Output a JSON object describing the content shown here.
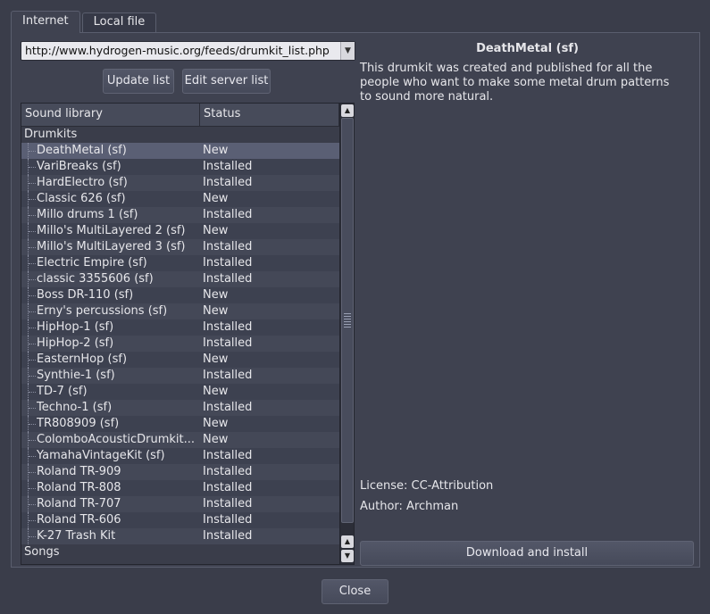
{
  "tabs": [
    {
      "label": "Internet",
      "active": true
    },
    {
      "label": "Local file",
      "active": false
    }
  ],
  "url": {
    "value": "http://www.hydrogen-music.org/feeds/drumkit_list.php"
  },
  "buttons": {
    "update_list": "Update list",
    "edit_server_list": "Edit server list",
    "download_install": "Download and install",
    "close": "Close"
  },
  "tree": {
    "headers": {
      "name": "Sound library",
      "status": "Status"
    },
    "groups": {
      "drumkits": "Drumkits",
      "songs": "Songs"
    },
    "items": [
      {
        "name": "DeathMetal (sf)",
        "status": "New",
        "selected": true
      },
      {
        "name": "VariBreaks (sf)",
        "status": "Installed"
      },
      {
        "name": "HardElectro (sf)",
        "status": "Installed"
      },
      {
        "name": "Classic 626 (sf)",
        "status": "New"
      },
      {
        "name": "Millo drums 1 (sf)",
        "status": "Installed"
      },
      {
        "name": "Millo's MultiLayered 2 (sf)",
        "status": "New"
      },
      {
        "name": "Millo's MultiLayered 3 (sf)",
        "status": "Installed"
      },
      {
        "name": "Electric Empire (sf)",
        "status": "Installed"
      },
      {
        "name": "classic 3355606 (sf)",
        "status": "Installed"
      },
      {
        "name": "Boss DR-110 (sf)",
        "status": "New"
      },
      {
        "name": "Erny's percussions (sf)",
        "status": "New"
      },
      {
        "name": "HipHop-1 (sf)",
        "status": "Installed"
      },
      {
        "name": "HipHop-2 (sf)",
        "status": "Installed"
      },
      {
        "name": "EasternHop (sf)",
        "status": "New"
      },
      {
        "name": "Synthie-1 (sf)",
        "status": "Installed"
      },
      {
        "name": "TD-7 (sf)",
        "status": "New"
      },
      {
        "name": "Techno-1 (sf)",
        "status": "Installed"
      },
      {
        "name": "TR808909 (sf)",
        "status": "New"
      },
      {
        "name": "ColomboAcousticDrumkit...",
        "status": "New"
      },
      {
        "name": "YamahaVintageKit (sf)",
        "status": "Installed"
      },
      {
        "name": "Roland TR-909",
        "status": "Installed"
      },
      {
        "name": "Roland TR-808",
        "status": "Installed"
      },
      {
        "name": "Roland TR-707",
        "status": "Installed"
      },
      {
        "name": "Roland TR-606",
        "status": "Installed"
      },
      {
        "name": "K-27 Trash Kit",
        "status": "Installed"
      }
    ]
  },
  "info": {
    "title": "DeathMetal (sf)",
    "description": "This drumkit was created and published for all the people who want to make some metal drum patterns to sound more natural.",
    "license": "License: CC-Attribution",
    "author": "Author: Archman"
  },
  "icons": {
    "combo_arrow": "chevron-down-icon",
    "scroll_up": "arrow-up-icon",
    "scroll_down": "arrow-down-icon"
  }
}
